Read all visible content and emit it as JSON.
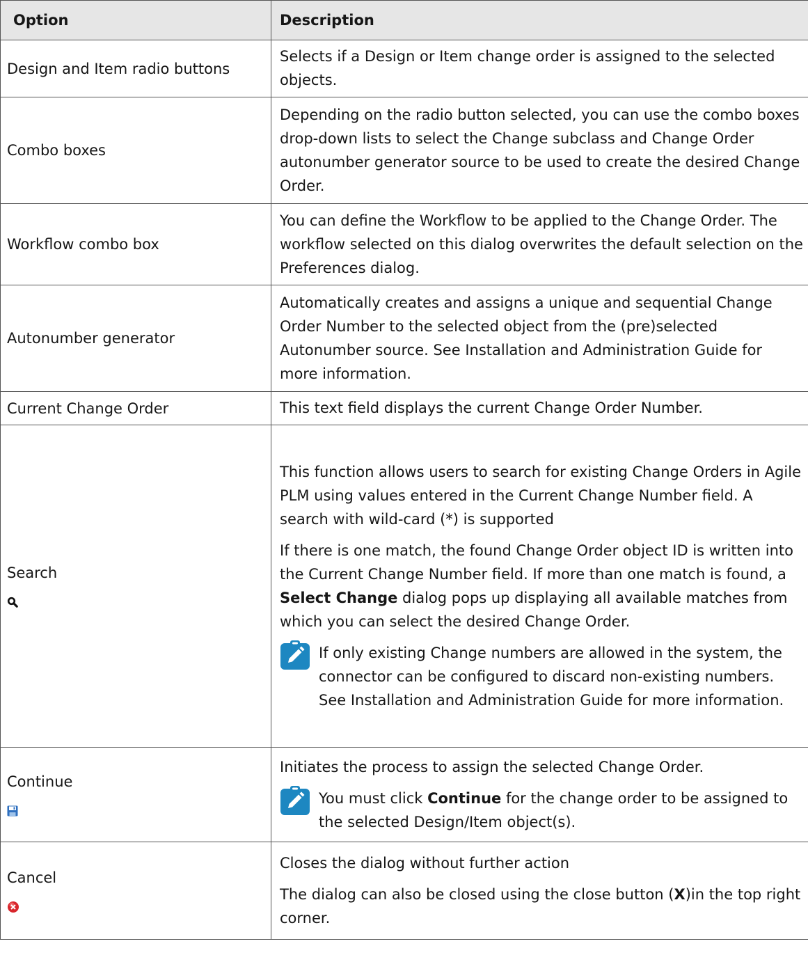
{
  "header": {
    "option": "Option",
    "description": "Description"
  },
  "rows": [
    {
      "option": "Design and Item radio buttons",
      "desc": "Selects if a Design or Item change order is assigned to the selected objects."
    },
    {
      "option": "Combo boxes",
      "desc": "Depending on the radio button selected, you can use the combo boxes drop-down lists to select the Change subclass and Change Order autonumber generator source to be used to create the desired Change Order."
    },
    {
      "option": "Workflow combo box",
      "desc": "You can define the Workflow to be applied to the Change Order. The workflow selected on this dialog overwrites the default selection on the Preferences dialog."
    },
    {
      "option": "Autonumber generator",
      "desc": "Automatically creates and assigns a unique and sequential Change Order Number to the selected object from the (pre)selected Autonumber source. See Installation and Administration Guide for more information."
    },
    {
      "option": "Current Change Order",
      "desc": "This text field displays the current Change Order Number."
    },
    {
      "option": "Search",
      "icon": "search-icon",
      "p1": "This function allows users to search for existing Change Orders in Agile PLM using values entered in the Current Change Number field. A search with wild-card (*) is supported",
      "p2_a": "If there is one match, the found Change Order object ID is written into the Current Change Number field. If more than one match is found, a ",
      "p2_bold": "Select Change",
      "p2_b": " dialog pops up displaying all available matches from which you can select the desired Change Order.",
      "note": "If only existing Change numbers are allowed in the system, the connector can be configured to discard non-existing numbers. See Installation and Administration Guide for more information."
    },
    {
      "option": "Continue",
      "icon": "save-icon",
      "p1": "Initiates the process to assign the selected Change Order.",
      "note_a": "You must click ",
      "note_bold": "Continue",
      "note_b": " for the change order to be assigned to the selected Design/Item object(s)."
    },
    {
      "option": "Cancel",
      "icon": "cancel-icon",
      "p1": "Closes the dialog without further action",
      "p2_a": "The dialog can also be closed using the close button (",
      "p2_bold": "X",
      "p2_b": ")in the top right corner."
    }
  ],
  "colors": {
    "header_bg": "#e6e6e6",
    "note_icon": "#1d87c1",
    "cancel_icon": "#d8262c",
    "save_icon": "#2e6fbf"
  }
}
